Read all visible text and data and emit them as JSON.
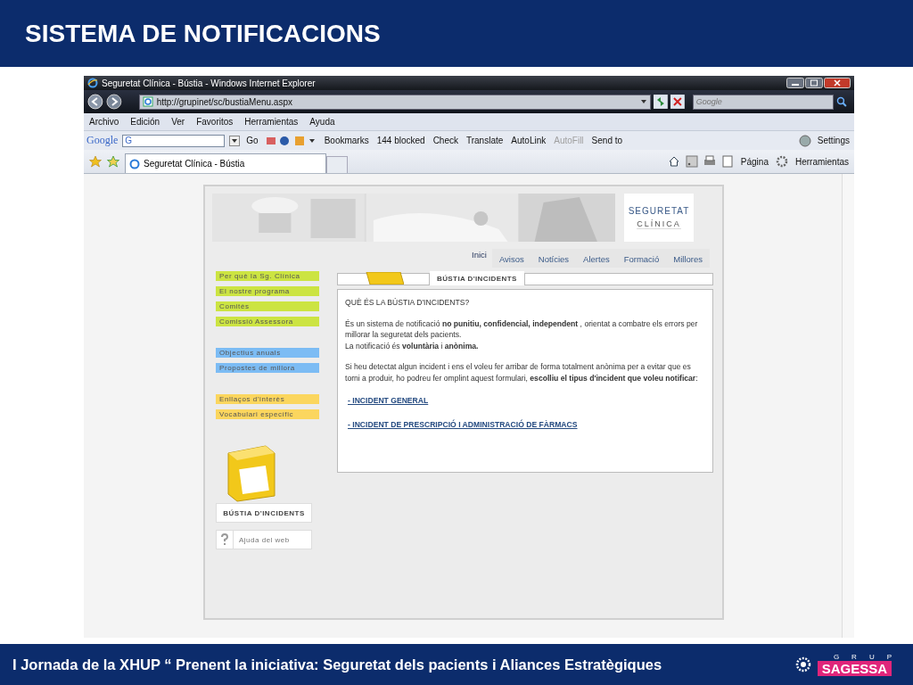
{
  "slide_title": "SISTEMA DE NOTIFICACIONS",
  "browser": {
    "window_title": "Seguretat Clínica - Bústia - Windows Internet Explorer",
    "address": "http://grupinet/sc/bustiaMenu.aspx",
    "search_placeholder": "Google",
    "menu": [
      "Archivo",
      "Edición",
      "Ver",
      "Favoritos",
      "Herramientas",
      "Ayuda"
    ],
    "google_logo": "Google",
    "google_g": "G",
    "go_label": "Go",
    "toolbar": [
      {
        "label": "Bookmarks",
        "disabled": false
      },
      {
        "label": "144 blocked",
        "disabled": false
      },
      {
        "label": "Check",
        "disabled": false
      },
      {
        "label": "Translate",
        "disabled": false
      },
      {
        "label": "AutoLink",
        "disabled": false
      },
      {
        "label": "AutoFill",
        "disabled": true
      },
      {
        "label": "Send to",
        "disabled": false
      }
    ],
    "settings_label": "Settings",
    "tab": "Seguretat Clínica - Bústia",
    "commands": [
      "Página",
      "Herramientas"
    ]
  },
  "page": {
    "logo": [
      "SEGURETAT",
      "CLÍNICA"
    ],
    "nav": [
      {
        "label": "Inici",
        "selected": true
      },
      {
        "label": "Avisos",
        "selected": false
      },
      {
        "label": "Notícies",
        "selected": false
      },
      {
        "label": "Alertes",
        "selected": false
      },
      {
        "label": "Formació",
        "selected": false
      },
      {
        "label": "Millores",
        "selected": false
      }
    ],
    "sidebar": [
      {
        "label": "Per què la Sg. Clínica",
        "color": "#cce442"
      },
      {
        "label": "El nostre programa",
        "color": "#cce442"
      },
      {
        "label": "Comitès",
        "color": "#cce442"
      },
      {
        "label": "Comissió Assessora",
        "color": "#cce442"
      },
      {
        "label": "Objectius anuals",
        "color": "#7cbcf4"
      },
      {
        "label": "Propostes de millora",
        "color": "#7cbcf4"
      },
      {
        "label": "Enllaços d'interès",
        "color": "#fbd65e"
      },
      {
        "label": "Vocabulari específic",
        "color": "#fbd65e"
      }
    ],
    "mailbox_label": "BÚSTIA D'INCIDENTS",
    "help_label": "Ajuda del web",
    "panel_tab": "BÚSTIA D'INCIDENTS",
    "heading": "QUÈ ÉS LA BÚSTIA D'INCIDENTS?",
    "paragraphs": [
      "És un sistema de notificació **no punitiu, confidencial, independent** , orientat a combatre els errors per millorar la seguretat dels pacients.",
      "La notificació és **voluntària** i **anònima.**",
      "Si heu detectat algun incident i ens el voleu fer arribar de forma totalment anònima per a evitar que es torni a produir, ho podreu fer omplint aquest formulari, **escolliu el tipus d'incident que voleu notificar**:"
    ],
    "links": [
      "- INCIDENT GENERAL",
      "- INCIDENT DE PRESCRIPCIÓ I ADMINISTRACIÓ DE FÀRMACS"
    ]
  },
  "footer": {
    "text": "I Jornada de la XHUP “ Prenent la iniciativa: Seguretat dels pacients i Aliances Estratègiques",
    "logo_top": "GRUP",
    "logo_name": "SAGESSA"
  }
}
